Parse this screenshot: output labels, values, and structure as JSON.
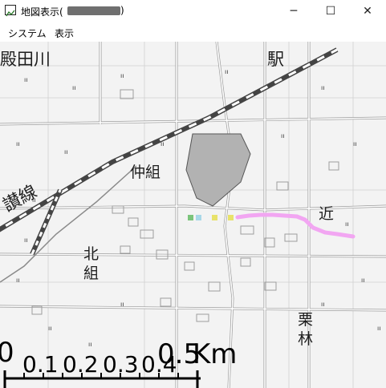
{
  "window": {
    "title": "地図表示(",
    "title_suffix": ")",
    "buttons": {
      "minimize": "─",
      "maximize": "☐",
      "close": "✕"
    }
  },
  "menu": {
    "items": [
      {
        "label": "システム"
      },
      {
        "label": "表示"
      }
    ]
  },
  "map": {
    "labels": {
      "river": "殿田川",
      "station": "駅",
      "nakagumi": "仲組",
      "line": "讃線",
      "kita": "北",
      "kumi": "組",
      "chika": "近",
      "kuri": "栗",
      "hayashi": "林"
    },
    "colors": {
      "track": "#f2a6f2",
      "pond": "#b2b2b2",
      "road": "#ffffff",
      "background": "#f3f3f3"
    },
    "scale_bar": {
      "labels": {
        "zero": "0",
        "n01": "0.1",
        "n02": "0.2",
        "n03": "0.3",
        "n04": "0.4",
        "n05": "0.5",
        "unit": "Km"
      }
    }
  }
}
